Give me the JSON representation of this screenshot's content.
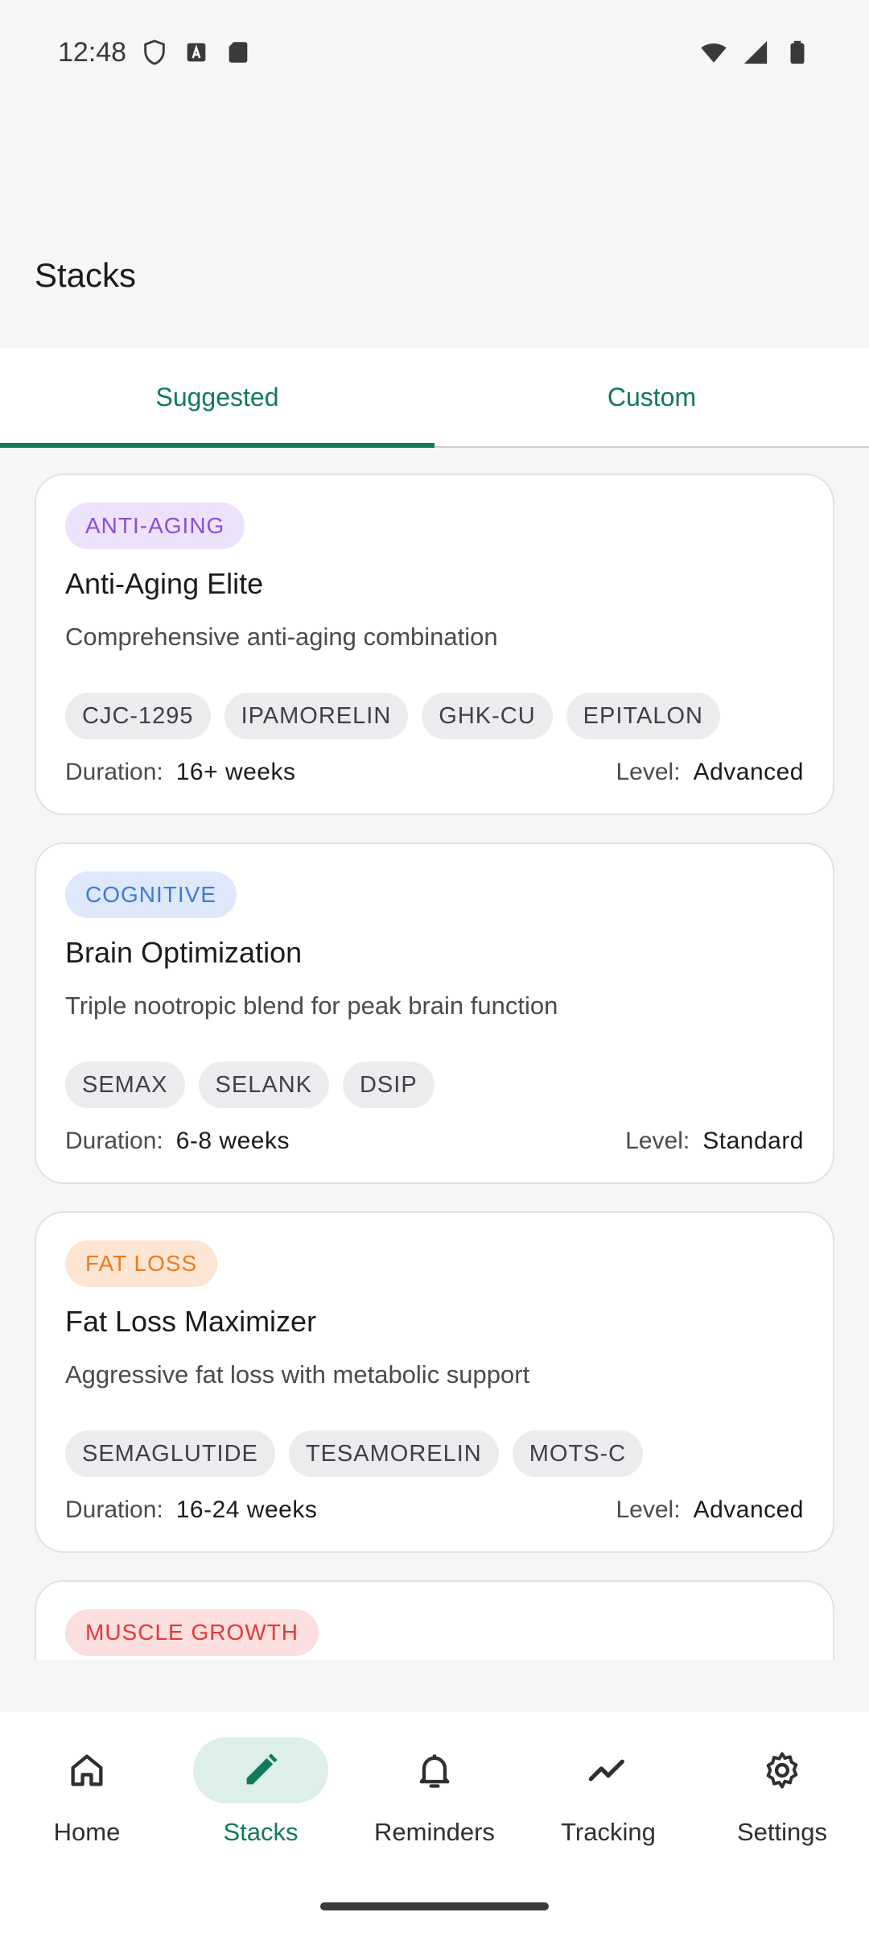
{
  "status": {
    "time": "12:48"
  },
  "header": {
    "title": "Stacks"
  },
  "tabs": [
    {
      "label": "Suggested",
      "active": true
    },
    {
      "label": "Custom",
      "active": false
    }
  ],
  "stacks": [
    {
      "category": "ANTI-AGING",
      "category_color": "#8a4fd8",
      "category_bg": "#ede2fb",
      "name": "Anti-Aging Elite",
      "description": "Comprehensive anti-aging combination",
      "peptides": [
        "CJC-1295",
        "IPAMORELIN",
        "GHK-CU",
        "EPITALON"
      ],
      "duration_label": "Duration:",
      "duration": "16+ weeks",
      "level_label": "Level:",
      "level": "Advanced"
    },
    {
      "category": "COGNITIVE",
      "category_color": "#3b7ae0",
      "category_bg": "#dde8fb",
      "name": "Brain Optimization",
      "description": "Triple nootropic blend for peak brain function",
      "peptides": [
        "SEMAX",
        "SELANK",
        "DSIP"
      ],
      "duration_label": "Duration:",
      "duration": "6-8 weeks",
      "level_label": "Level:",
      "level": "Standard"
    },
    {
      "category": "FAT LOSS",
      "category_color": "#ef7a1e",
      "category_bg": "#fde5d3",
      "name": "Fat Loss Maximizer",
      "description": "Aggressive fat loss with metabolic support",
      "peptides": [
        "SEMAGLUTIDE",
        "TESAMORELIN",
        "MOTS-C"
      ],
      "duration_label": "Duration:",
      "duration": "16-24 weeks",
      "level_label": "Level:",
      "level": "Advanced"
    },
    {
      "category": "MUSCLE GROWTH",
      "category_color": "#e0393b",
      "category_bg": "#fbdede"
    }
  ],
  "nav": [
    {
      "label": "Home",
      "icon": "home-icon",
      "active": false
    },
    {
      "label": "Stacks",
      "icon": "pencil-icon",
      "active": true
    },
    {
      "label": "Reminders",
      "icon": "bell-icon",
      "active": false
    },
    {
      "label": "Tracking",
      "icon": "trend-icon",
      "active": false
    },
    {
      "label": "Settings",
      "icon": "gear-icon",
      "active": false
    }
  ],
  "colors": {
    "accent": "#117a5a"
  }
}
